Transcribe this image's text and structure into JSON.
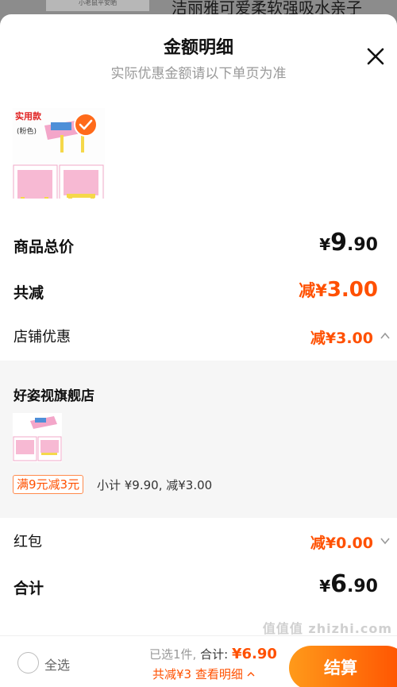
{
  "background": {
    "thumb_text": "小老鼠平安晒",
    "title": "洁丽雅可爱柔软强吸水亲子"
  },
  "sheet": {
    "title": "金额明细",
    "subtitle": "实际优惠金额请以下单页为准",
    "close_icon": "close-icon"
  },
  "product": {
    "label_top": "实用款",
    "label_color": "(粉色)"
  },
  "summary": {
    "total_label": "商品总价",
    "total_yen": "¥",
    "total_int": "9",
    "total_dec": ".90",
    "reduce_label": "共减",
    "reduce_prefix": "减¥",
    "reduce_value": "3.00",
    "shop_discount_label": "店铺优惠",
    "shop_discount_value": "减¥3.00"
  },
  "shop": {
    "name": "好姿视旗舰店",
    "promo_tag": "满9元减3元",
    "subtotal": "小计 ¥9.90, 减¥3.00"
  },
  "redpacket": {
    "label": "红包",
    "value": "减¥0.00"
  },
  "final": {
    "label": "合计",
    "yen": "¥",
    "int": "6",
    "dec": ".90"
  },
  "bottom_bar": {
    "select_all": "全选",
    "selected": "已选1件,",
    "total_label": "合计:",
    "total_amount": "¥6.90",
    "detail": "共减¥3  查看明细",
    "checkout": "结算"
  },
  "watermark": "值值值 zhizhi.com",
  "colors": {
    "accent": "#ff5000",
    "checkout_start": "#ff9a1a",
    "panel_bg": "#f6f6f6"
  }
}
